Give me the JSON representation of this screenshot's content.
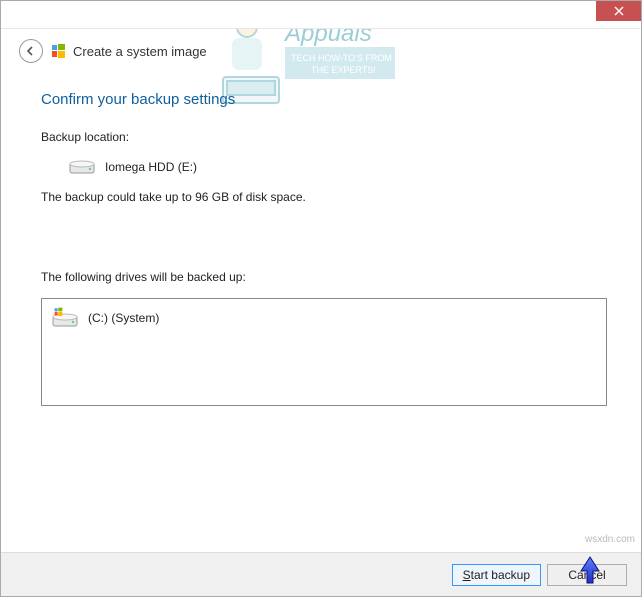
{
  "titlebar": {
    "close_name": "close-icon"
  },
  "header": {
    "title": "Create a system image"
  },
  "main": {
    "heading": "Confirm your backup settings",
    "backup_loc_label": "Backup location:",
    "backup_loc_value": "Iomega HDD (E:)",
    "space_note": "The backup could take up to 96 GB of disk space.",
    "drives_label": "The following drives will be backed up:",
    "drives": [
      {
        "label": "(C:) (System)"
      }
    ]
  },
  "footer": {
    "start_label_prefix": "S",
    "start_label_rest": "tart backup",
    "cancel_label": "Cancel"
  },
  "watermark": {
    "brand": "Appuals",
    "line1": "TECH HOW-TO'S FROM",
    "line2": "THE EXPERTS!",
    "site": "wsxdn.com"
  }
}
